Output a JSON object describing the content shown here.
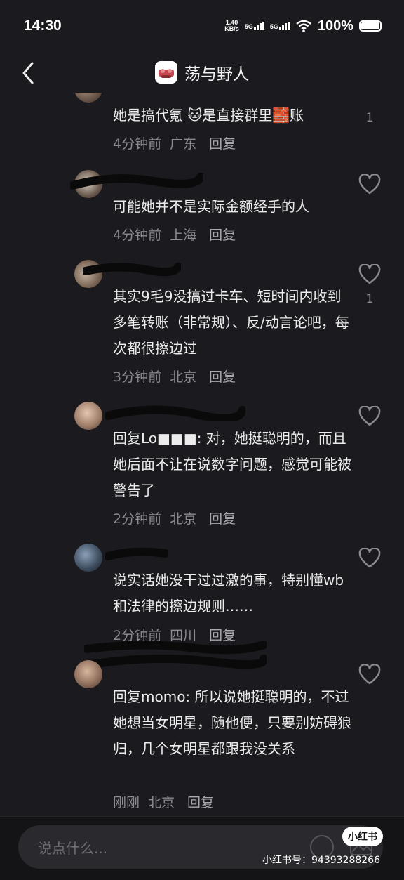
{
  "status_bar": {
    "time": "14:30",
    "speed_value": "1.40",
    "speed_unit": "KB/s",
    "sig1": "5G",
    "sig2": "5G",
    "battery": "100%"
  },
  "header": {
    "title": "荡与野人",
    "back_icon": "chevron-left-icon"
  },
  "comments": [
    {
      "text": "她是搞代氪 🐱是直接群里🧱账",
      "time": "4分钟前",
      "location": "广东",
      "reply": "回复",
      "likes": "1"
    },
    {
      "text": "可能她并不是实际金额经手的人",
      "time": "4分钟前",
      "location": "上海",
      "reply": "回复",
      "likes": ""
    },
    {
      "text": "其实9毛9没搞过卡车、短时间内收到多笔转账（非常规）、反/动言论吧，每次都很擦边过",
      "time": "3分钟前",
      "location": "北京",
      "reply": "回复",
      "likes": "1"
    },
    {
      "text": "回复Lo■■■: 对，她挺聪明的，而且她后面不让在说数字问题，感觉可能被警告了",
      "time": "2分钟前",
      "location": "北京",
      "reply": "回复",
      "likes": ""
    },
    {
      "text": "说实话她没干过过激的事，特别懂wb和法律的擦边规则……",
      "time": "2分钟前",
      "location": "四川",
      "reply": "回复",
      "likes": ""
    },
    {
      "text": "回复momo: 所以说她挺聪明的，不过她想当女明星，随他便，只要别妨碍狼归，几个女明星都跟我没关系",
      "time": "刚刚",
      "location": "北京",
      "reply": "回复",
      "likes": ""
    }
  ],
  "input": {
    "placeholder": "说点什么..."
  },
  "watermark": {
    "badge": "小红书",
    "text": "小红书号：94393288266"
  },
  "colors": {
    "background": "#1b1b1f",
    "text": "#ececec",
    "meta": "#8b8b8f"
  }
}
